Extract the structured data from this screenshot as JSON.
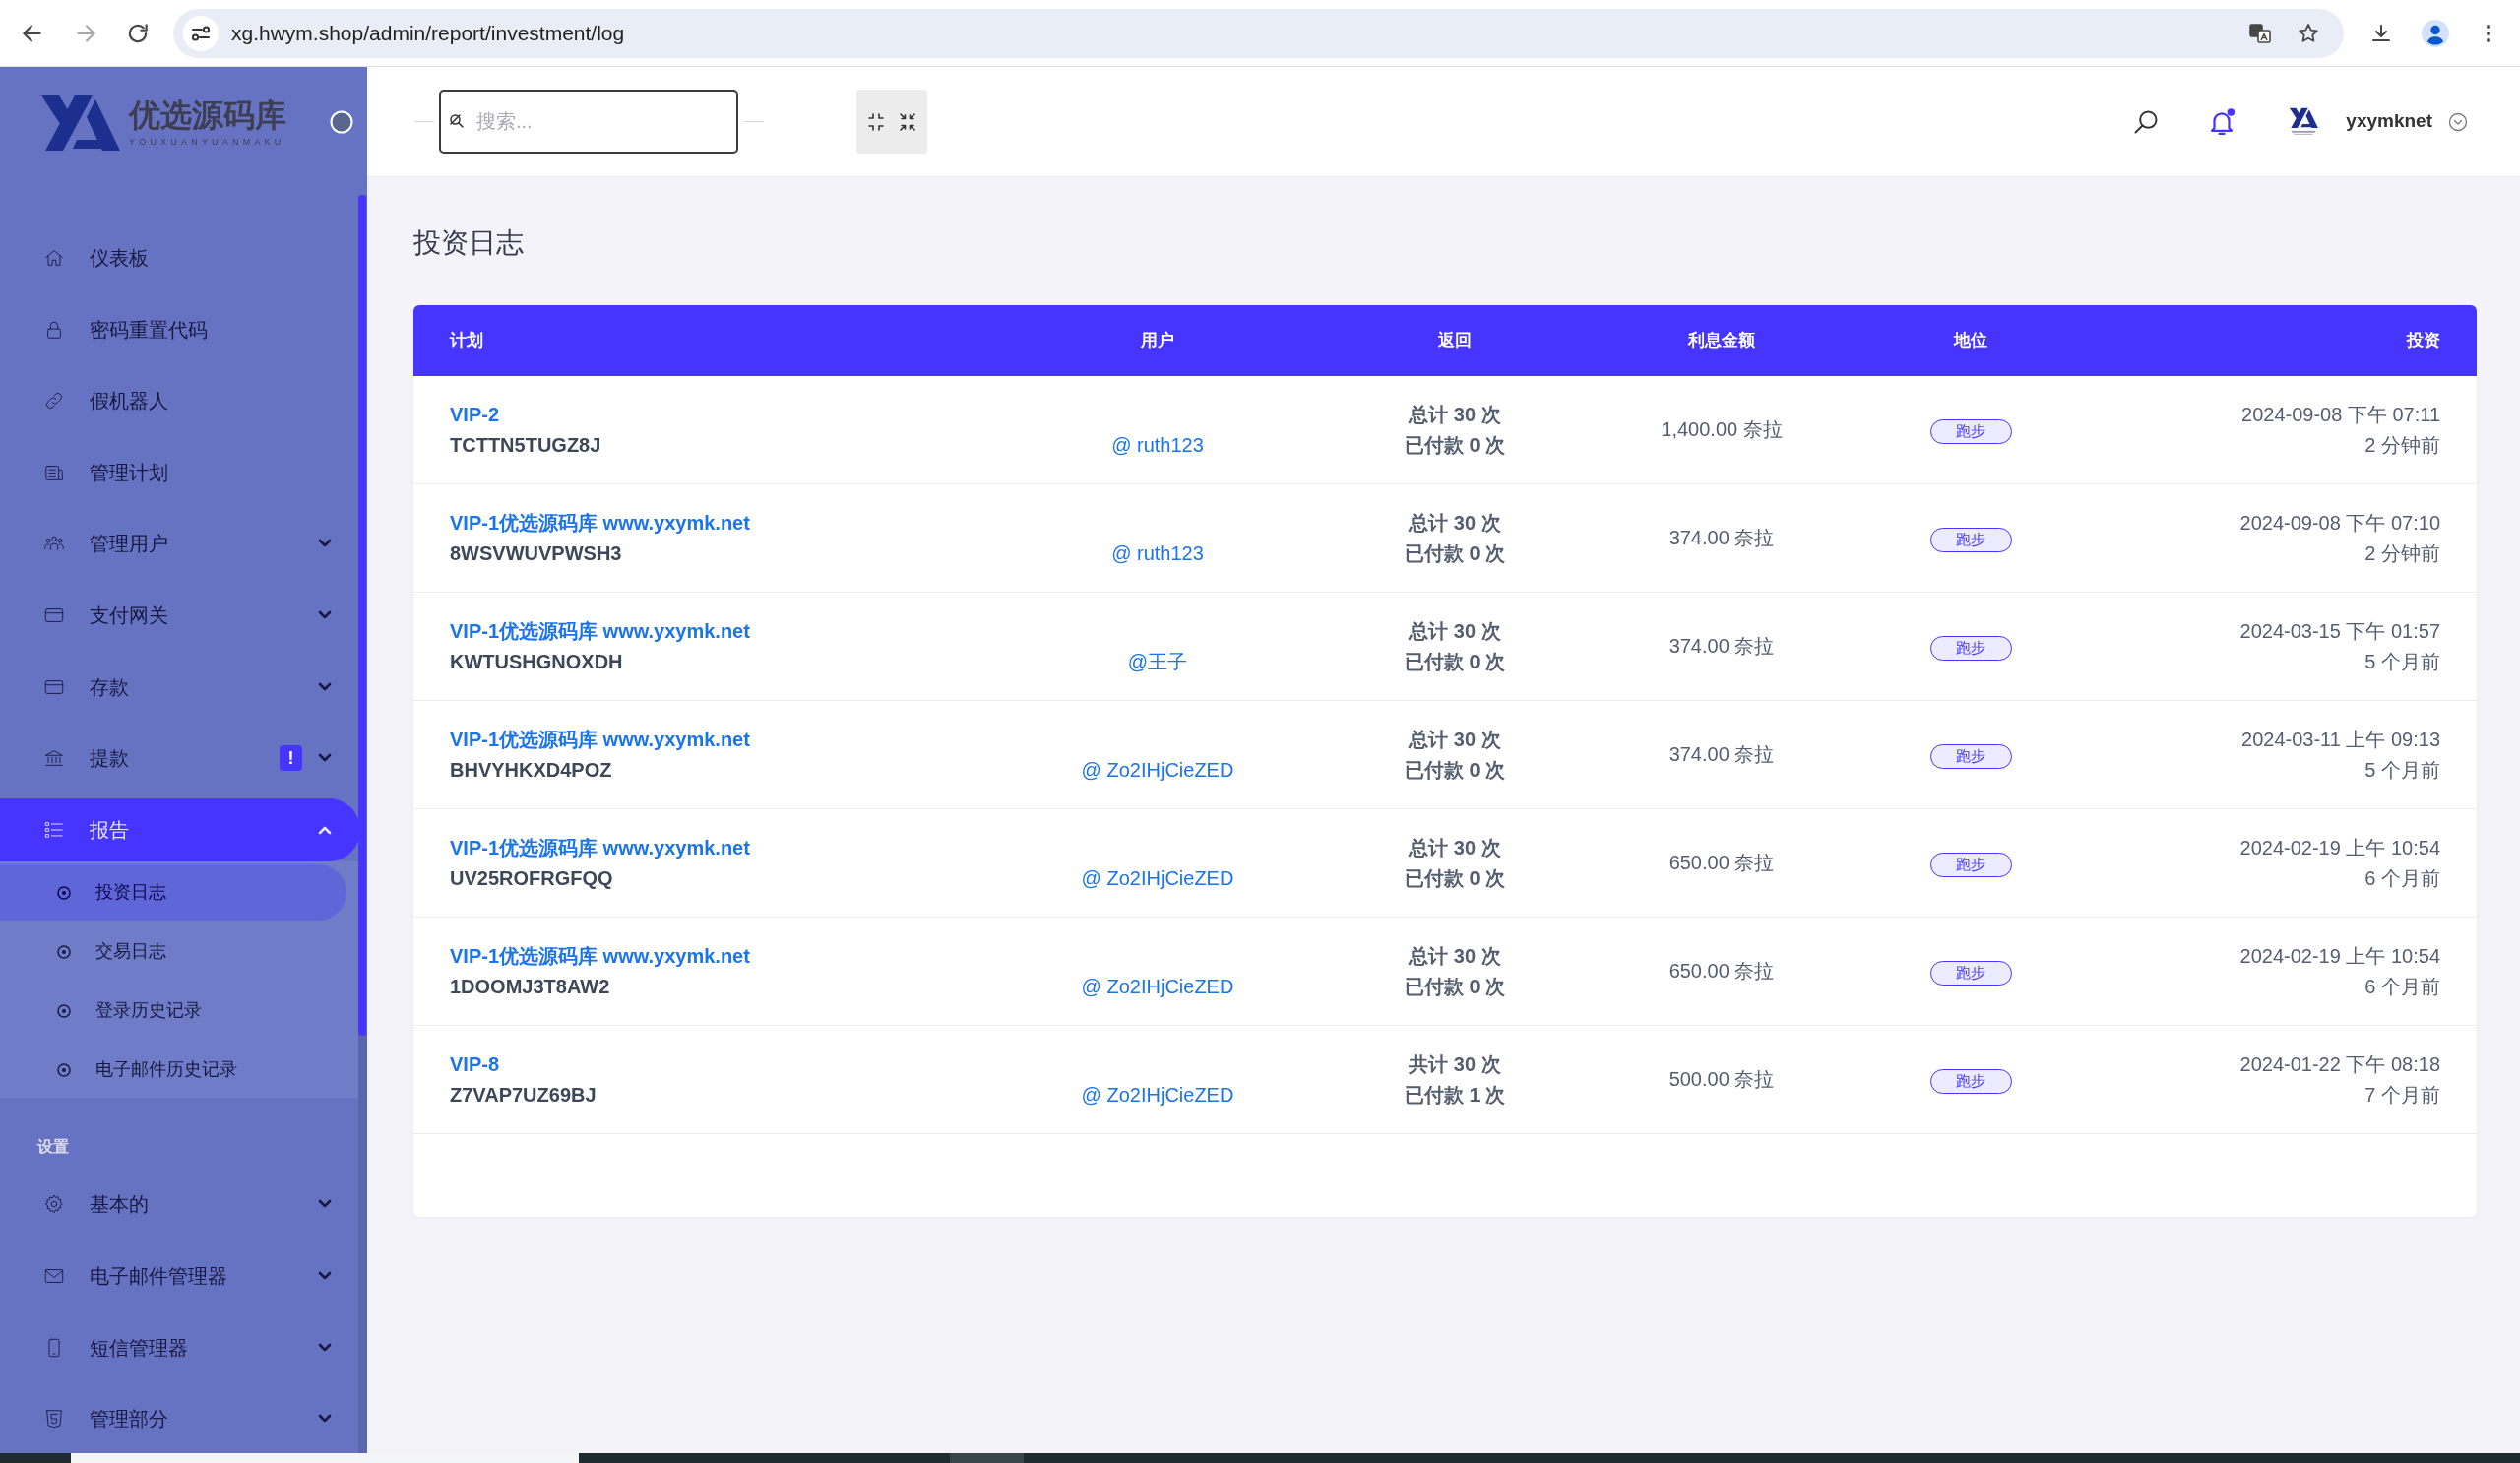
{
  "browser": {
    "url": "xg.hwym.shop/admin/report/investment/log"
  },
  "sidebar": {
    "logo": {
      "name": "优选源码库",
      "tagline": "YOUXUANYUANMAKU"
    },
    "groups": [
      {
        "items": [
          {
            "label": "仪表板",
            "kind": "link",
            "selected": false
          },
          {
            "label": "密码重置代码",
            "kind": "link",
            "selected": false
          },
          {
            "label": "假机器人",
            "kind": "link",
            "selected": false
          },
          {
            "label": "管理计划",
            "kind": "link",
            "selected": false
          },
          {
            "label": "管理用户",
            "kind": "dropdown",
            "selected": false,
            "expanded": false
          },
          {
            "label": "支付网关",
            "kind": "dropdown",
            "selected": false,
            "expanded": false
          },
          {
            "label": "存款",
            "kind": "dropdown",
            "selected": false,
            "expanded": false
          },
          {
            "label": "提款",
            "kind": "dropdown",
            "selected": false,
            "expanded": false,
            "badge": "!"
          },
          {
            "label": "报告",
            "kind": "dropdown",
            "selected": true,
            "expanded": true,
            "children": [
              {
                "label": "投资日志",
                "selected": true
              },
              {
                "label": "交易日志",
                "selected": false
              },
              {
                "label": "登录历史记录",
                "selected": false
              },
              {
                "label": "电子邮件历史记录",
                "selected": false
              }
            ]
          }
        ]
      },
      {
        "heading": "设置",
        "items": [
          {
            "label": "基本的",
            "kind": "dropdown",
            "selected": false,
            "expanded": false
          },
          {
            "label": "电子邮件管理器",
            "kind": "dropdown",
            "selected": false,
            "expanded": false
          },
          {
            "label": "短信管理器",
            "kind": "dropdown",
            "selected": false,
            "expanded": false
          },
          {
            "label": "管理部分",
            "kind": "dropdown",
            "selected": false,
            "expanded": false
          }
        ]
      }
    ]
  },
  "topbar": {
    "search": {
      "placeholder": "搜索..."
    },
    "notifications": {
      "unread": true
    },
    "user": {
      "name": "yxymknet"
    }
  },
  "page": {
    "title": "投资日志"
  },
  "table": {
    "columns": [
      "计划",
      "用户",
      "返回",
      "利息金额",
      "地位",
      "投资"
    ],
    "rows": [
      {
        "plan": "VIP-2",
        "code": "TCTTN5TUGZ8J",
        "user": "@ ruth123",
        "return_total": "总计 30 次",
        "return_paid": "已付款 0 次",
        "interest": "1,400.00 奈拉",
        "status": "跑步",
        "date": "2024-09-08 下午 07:11",
        "ago": "2 分钟前"
      },
      {
        "plan": "VIP-1优选源码库 www.yxymk.net",
        "code": "8WSVWUVPWSH3",
        "user": "@ ruth123",
        "return_total": "总计 30 次",
        "return_paid": "已付款 0 次",
        "interest": "374.00 奈拉",
        "status": "跑步",
        "date": "2024-09-08 下午 07:10",
        "ago": "2 分钟前"
      },
      {
        "plan": "VIP-1优选源码库 www.yxymk.net",
        "code": "KWTUSHGNOXDH",
        "user": "@王子",
        "return_total": "总计 30 次",
        "return_paid": "已付款 0 次",
        "interest": "374.00 奈拉",
        "status": "跑步",
        "date": "2024-03-15 下午 01:57",
        "ago": "5 个月前"
      },
      {
        "plan": "VIP-1优选源码库 www.yxymk.net",
        "code": "BHVYHKXD4POZ",
        "user": "@ Zo2IHjCieZED",
        "return_total": "总计 30 次",
        "return_paid": "已付款 0 次",
        "interest": "374.00 奈拉",
        "status": "跑步",
        "date": "2024-03-11 上午 09:13",
        "ago": "5 个月前"
      },
      {
        "plan": "VIP-1优选源码库 www.yxymk.net",
        "code": "UV25ROFRGFQQ",
        "user": "@ Zo2IHjCieZED",
        "return_total": "总计 30 次",
        "return_paid": "已付款 0 次",
        "interest": "650.00 奈拉",
        "status": "跑步",
        "date": "2024-02-19 上午 10:54",
        "ago": "6 个月前"
      },
      {
        "plan": "VIP-1优选源码库 www.yxymk.net",
        "code": "1DOOMJ3T8AW2",
        "user": "@ Zo2IHjCieZED",
        "return_total": "总计 30 次",
        "return_paid": "已付款 0 次",
        "interest": "650.00 奈拉",
        "status": "跑步",
        "date": "2024-02-19 上午 10:54",
        "ago": "6 个月前"
      },
      {
        "plan": "VIP-8",
        "code": "Z7VAP7UZ69BJ",
        "user": "@ Zo2IHjCieZED",
        "return_total": "共计 30 次",
        "return_paid": "已付款 1 次",
        "interest": "500.00 奈拉",
        "status": "跑步",
        "date": "2024-01-22 下午 08:18",
        "ago": "7 个月前"
      }
    ]
  }
}
